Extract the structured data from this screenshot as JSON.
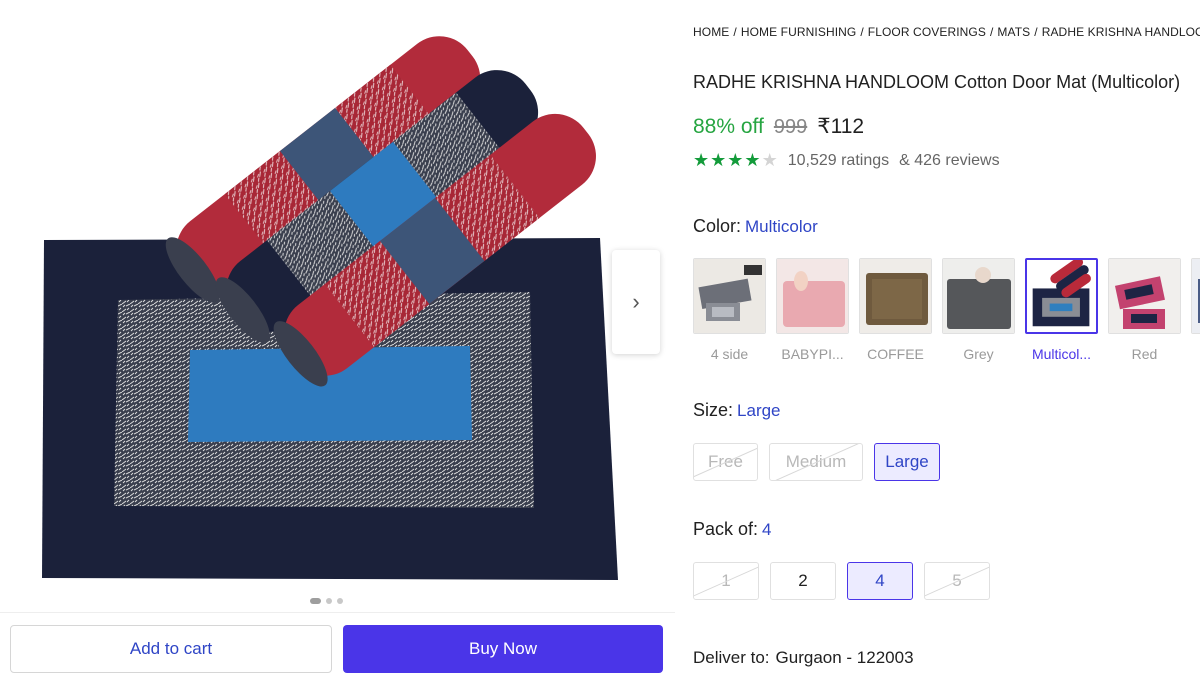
{
  "breadcrumb": [
    "HOME",
    "HOME FURNISHING",
    "FLOOR COVERINGS",
    "MATS",
    "RADHE KRISHNA HANDLOOM MATS"
  ],
  "product": {
    "title": "RADHE KRISHNA HANDLOOM Cotton Door Mat (Multicolor)",
    "discount": "88% off",
    "mrp": "999",
    "price": "₹112",
    "rating_stars": 4,
    "ratings_text": "10,529 ratings",
    "reviews_text": "& 426 reviews"
  },
  "color": {
    "label": "Color:",
    "selected": "Multicolor",
    "options": [
      {
        "label": "4 side"
      },
      {
        "label": "BABYPI..."
      },
      {
        "label": "COFFEE"
      },
      {
        "label": "Grey"
      },
      {
        "label": "Multicol..."
      },
      {
        "label": "Red"
      },
      {
        "label": ""
      }
    ],
    "swatch_colors": {
      "pink": "#e9a9b0",
      "coffee": "#6f5a3e",
      "grey": "#55575a",
      "navy": "#1d2444",
      "red": "#b92a3a",
      "blue": "#2f7fbf"
    }
  },
  "size": {
    "label": "Size:",
    "selected": "Large",
    "options": [
      {
        "label": "Free",
        "state": "disabled"
      },
      {
        "label": "Medium",
        "state": "disabled"
      },
      {
        "label": "Large",
        "state": "selected"
      }
    ]
  },
  "pack": {
    "label": "Pack of:",
    "selected": "4",
    "options": [
      {
        "label": "1",
        "state": "disabled"
      },
      {
        "label": "2",
        "state": "normal"
      },
      {
        "label": "4",
        "state": "selected"
      },
      {
        "label": "5",
        "state": "disabled"
      }
    ]
  },
  "deliver": {
    "label": "Deliver to:",
    "location": "Gurgaon - 122003"
  },
  "actions": {
    "add_to_cart": "Add to cart",
    "buy_now": "Buy Now"
  },
  "gallery": {
    "next_icon": "chevron-right-icon",
    "image_count": 3,
    "active_index": 0
  },
  "theme": {
    "accent": "#4a35e8",
    "link": "#2f45c6",
    "discount_green": "#26a541",
    "star_green": "#139b3a"
  }
}
